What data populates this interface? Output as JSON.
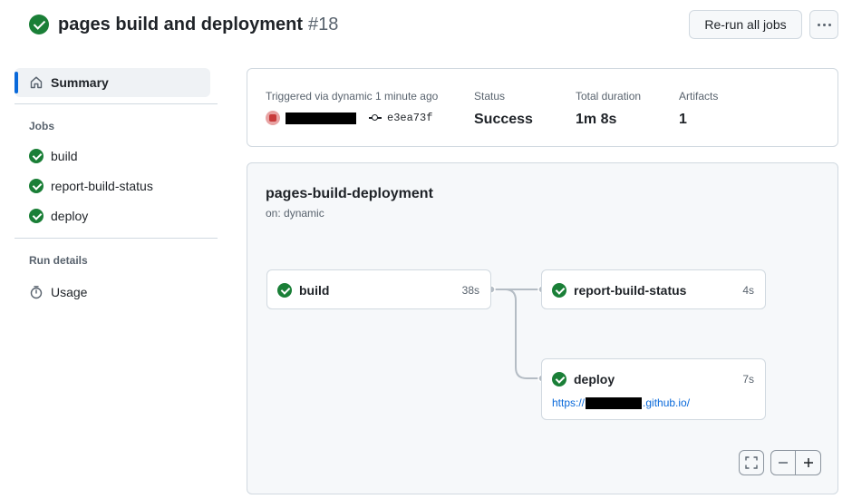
{
  "header": {
    "title": "pages build and deployment",
    "run_number": "#18",
    "rerun_label": "Re-run all jobs",
    "more_icon": "kebab-horizontal-icon"
  },
  "sidebar": {
    "summary_label": "Summary",
    "jobs_heading": "Jobs",
    "jobs": [
      {
        "label": "build",
        "status": "success"
      },
      {
        "label": "report-build-status",
        "status": "success"
      },
      {
        "label": "deploy",
        "status": "success"
      }
    ],
    "run_details_heading": "Run details",
    "usage_label": "Usage"
  },
  "summary": {
    "trigger_label": "Triggered via dynamic 1 minute ago",
    "commit_sha": "e3ea73f",
    "status_label": "Status",
    "status_value": "Success",
    "duration_label": "Total duration",
    "duration_value": "1m 8s",
    "artifacts_label": "Artifacts",
    "artifacts_value": "1"
  },
  "workflow": {
    "name": "pages-build-deployment",
    "trigger": "on: dynamic",
    "jobs": {
      "build": {
        "name": "build",
        "duration": "38s"
      },
      "report": {
        "name": "report-build-status",
        "duration": "4s"
      },
      "deploy": {
        "name": "deploy",
        "duration": "7s",
        "url_prefix": "https://",
        "url_suffix": ".github.io/"
      }
    }
  },
  "colors": {
    "success": "#1a7f37",
    "accent": "#0969da",
    "border": "#d1d9e0",
    "muted_text": "#59636e"
  }
}
